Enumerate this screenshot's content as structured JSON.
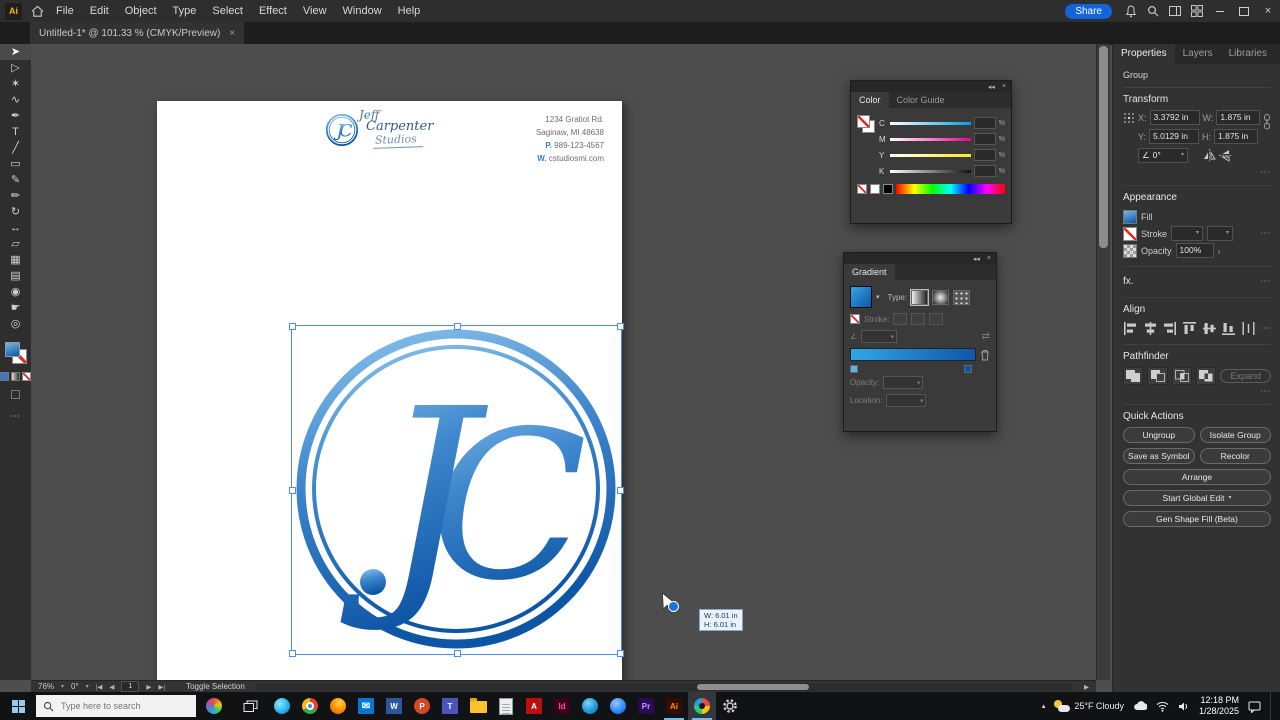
{
  "icons": {
    "close": "×",
    "minimize": "–",
    "chev_down": "▾",
    "chev_right": "›",
    "chev_up": "▴",
    "ellipsis": "⋯",
    "angle": "∠",
    "reverse": "⇄",
    "collapse": "◂◂",
    "nav_first": "|◀",
    "nav_prev": "◀",
    "nav_next": "▶",
    "nav_last": "▶|",
    "percent": "%"
  },
  "titlebar": {
    "app_badge": "Ai",
    "menus": [
      "File",
      "Edit",
      "Object",
      "Type",
      "Select",
      "Effect",
      "View",
      "Window",
      "Help"
    ],
    "share": "Share"
  },
  "doc_tab": "Untitled-1* @ 101.33 % (CMYK/Preview)",
  "tools": [
    {
      "name": "selection-tool",
      "glyph": "➤"
    },
    {
      "name": "direct-selection-tool",
      "glyph": "▷"
    },
    {
      "name": "magic-wand-tool",
      "glyph": "✶"
    },
    {
      "name": "lasso-tool",
      "glyph": "∿"
    },
    {
      "name": "pen-tool",
      "glyph": "✒"
    },
    {
      "name": "type-tool",
      "glyph": "T"
    },
    {
      "name": "line-segment-tool",
      "glyph": "╱"
    },
    {
      "name": "rectangle-tool",
      "glyph": "▭"
    },
    {
      "name": "paintbrush-tool",
      "glyph": "✎"
    },
    {
      "name": "pencil-tool",
      "glyph": "✏"
    },
    {
      "name": "rotate-tool",
      "glyph": "↻"
    },
    {
      "name": "width-tool",
      "glyph": "↔"
    },
    {
      "name": "shape-builder-tool",
      "glyph": "▱"
    },
    {
      "name": "mesh-tool",
      "glyph": "▦"
    },
    {
      "name": "gradient-tool",
      "glyph": "▤"
    },
    {
      "name": "eyedropper-tool",
      "glyph": "◉"
    },
    {
      "name": "hand-tool",
      "glyph": "☛"
    },
    {
      "name": "zoom-tool",
      "glyph": "◎"
    }
  ],
  "letterhead": {
    "brand_top": "Jeff",
    "brand_mid": "Carpenter",
    "brand_script": "Studios",
    "monogram": "JC",
    "monogram_j": "J",
    "monogram_c": "C",
    "address1": "1234 Gratiot Rd.",
    "address2": "Saginaw, MI 48638",
    "phone_label": "P.",
    "phone": "989-123-4567",
    "web_label": "W.",
    "web": "cstudiosmi.com"
  },
  "color_panel": {
    "tab_color": "Color",
    "tab_guide": "Color Guide",
    "channels": [
      "C",
      "M",
      "Y",
      "K"
    ]
  },
  "gradient_panel": {
    "title": "Gradient",
    "type_label": "Type:",
    "stroke_label": "Stroke:",
    "opacity_label": "Opacity:",
    "location_label": "Location:"
  },
  "props": {
    "tabs": [
      "Properties",
      "Layers",
      "Libraries"
    ],
    "selection": "Group",
    "transform": "Transform",
    "x": "X:",
    "xv": "3.3792 in",
    "y": "Y:",
    "yv": "5.0129 in",
    "w": "W:",
    "wv": "1.875 in",
    "h": "H:",
    "hv": "1.875 in",
    "rot": "0°",
    "appearance": "Appearance",
    "fill": "Fill",
    "stroke": "Stroke",
    "opacity": "Opacity",
    "opv": "100%",
    "fx": "fx.",
    "align": "Align",
    "pathfinder": "Pathfinder",
    "expand": "Expand",
    "quick": "Quick Actions",
    "actions": [
      "Ungroup",
      "Isolate Group",
      "Save as Symbol",
      "Recolor",
      "Arrange",
      "Start Global Edit",
      "Gen Shape Fill (Beta)"
    ]
  },
  "status": {
    "zoom": "76%",
    "rotation": "0°",
    "board": "1",
    "hint": "Toggle Selection"
  },
  "size_tooltip": {
    "w": "W: 6.01 in",
    "h": "H: 6.01 in"
  },
  "taskbar": {
    "search_placeholder": "Type here to search",
    "weather": "25°F Cloudy",
    "time": "12:18 PM",
    "date": "1/28/2025"
  }
}
